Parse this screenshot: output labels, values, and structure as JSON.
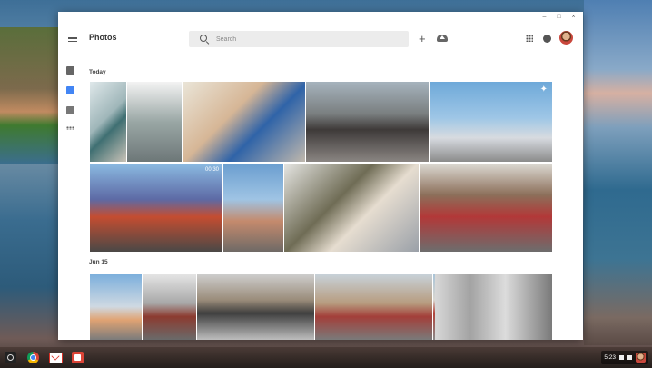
{
  "app": {
    "title": "Photos"
  },
  "search": {
    "placeholder": "Search",
    "value": ""
  },
  "toolbar": {
    "menu_icon": "menu-icon",
    "add_icon": "add-icon",
    "upload_icon": "cloud-upload-icon",
    "apps_icon": "apps-grid-icon",
    "notifications_icon": "notifications-icon",
    "avatar_icon": "avatar"
  },
  "window_controls": [
    "–",
    "□",
    "×"
  ],
  "rail": {
    "items": [
      {
        "name": "assistant",
        "icon": "assistant-icon"
      },
      {
        "name": "photos",
        "icon": "photos-icon",
        "active": true
      },
      {
        "name": "albums",
        "icon": "albums-icon"
      },
      {
        "name": "more",
        "icon": "more-dots-icon"
      }
    ]
  },
  "sections": [
    {
      "label": "Today",
      "rows": [
        [
          {
            "id": "p1"
          },
          {
            "id": "p2"
          },
          {
            "id": "p3"
          },
          {
            "id": "p4"
          },
          {
            "id": "p5",
            "badge": "sparkle"
          }
        ],
        [
          {
            "id": "p6",
            "duration": "00:30"
          },
          {
            "id": "p7"
          },
          {
            "id": "p8"
          },
          {
            "id": "p9"
          }
        ]
      ]
    },
    {
      "label": "Jun 15",
      "rows": [
        [
          {
            "id": "p10"
          },
          {
            "id": "p11"
          },
          {
            "id": "p12"
          },
          {
            "id": "p13"
          },
          {
            "id": "p14"
          },
          {
            "id": "p15"
          }
        ]
      ]
    }
  ],
  "shelf": {
    "apps": [
      "launcher-icon",
      "chrome-icon",
      "gmail-icon",
      "photos-icon"
    ],
    "clock": "5:23"
  },
  "colors": {
    "accent": "#4285f4",
    "search_bg": "#ececec",
    "title_text": "#333333"
  }
}
